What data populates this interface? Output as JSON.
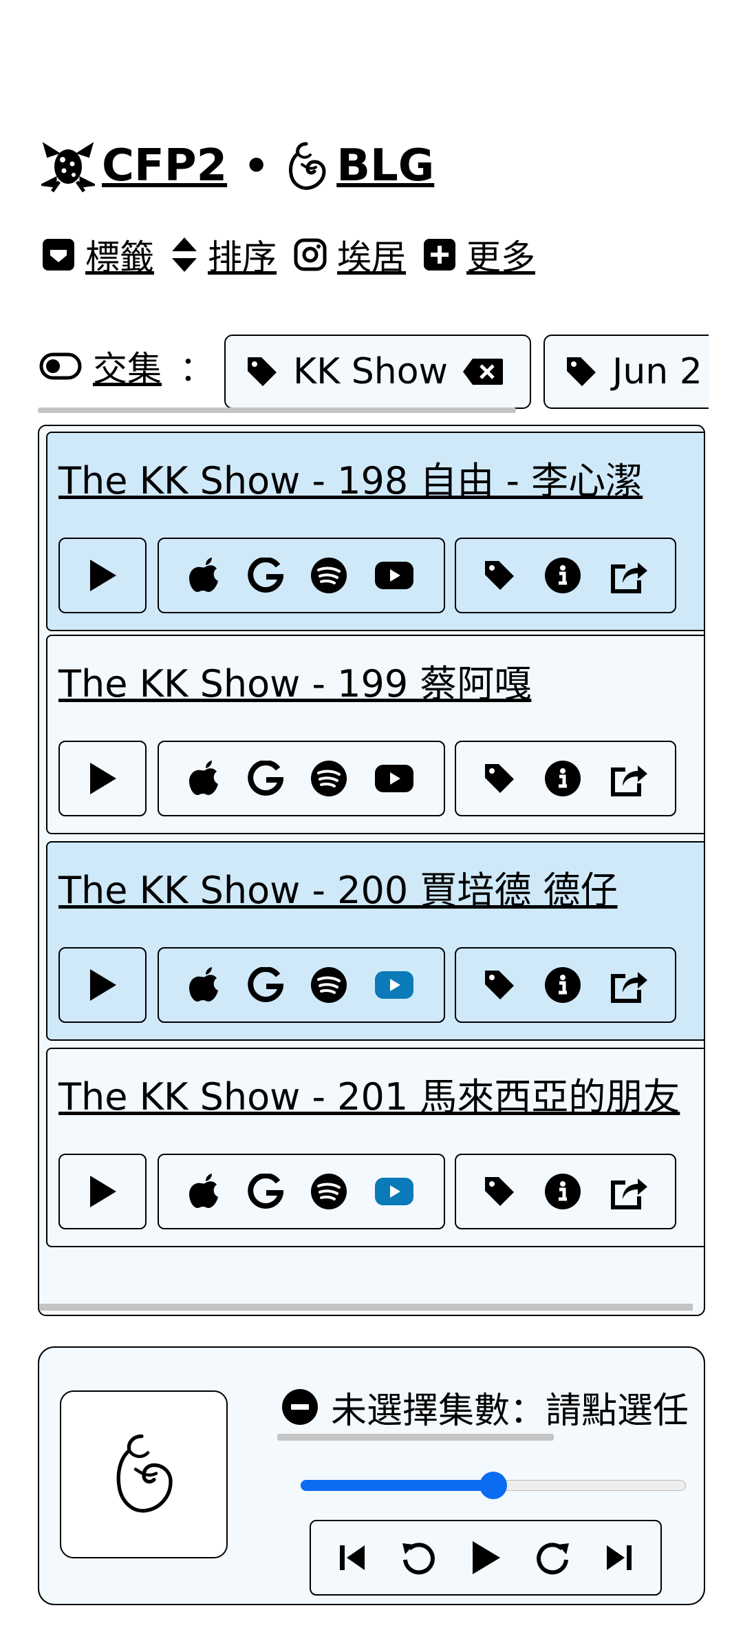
{
  "header": {
    "brand": "CFP2",
    "separator": "•",
    "section": "BLG"
  },
  "menu": [
    {
      "label": "標籤",
      "icon": "tag-square-icon"
    },
    {
      "label": "排序",
      "icon": "sort-icon"
    },
    {
      "label": "埃居",
      "icon": "instagram-icon"
    },
    {
      "label": "更多",
      "icon": "plus-square-icon"
    }
  ],
  "filter": {
    "mode_label": "交集",
    "colon": "：",
    "chips": [
      {
        "label": "KK Show",
        "removable": true
      },
      {
        "label": "Jun 2"
      }
    ]
  },
  "episodes": [
    {
      "title": "The KK Show - 198 自由 - 李心潔",
      "highlight": true,
      "youtube_active": false
    },
    {
      "title": "The KK Show - 199 蔡阿嘎",
      "highlight": false,
      "youtube_active": false
    },
    {
      "title": "The KK Show - 200 賈培德 德仔",
      "highlight": true,
      "youtube_active": true
    },
    {
      "title": "The KK Show - 201 馬來西亞的朋友",
      "highlight": false,
      "youtube_active": true
    }
  ],
  "player": {
    "status": "未選擇集數：請點選任",
    "progress": 0.5
  },
  "colors": {
    "accent": "#0a6cf0",
    "youtube_active": "#0a7ab8",
    "row_highlight": "#cfe9f9",
    "row_plain": "#f3f9fd"
  }
}
